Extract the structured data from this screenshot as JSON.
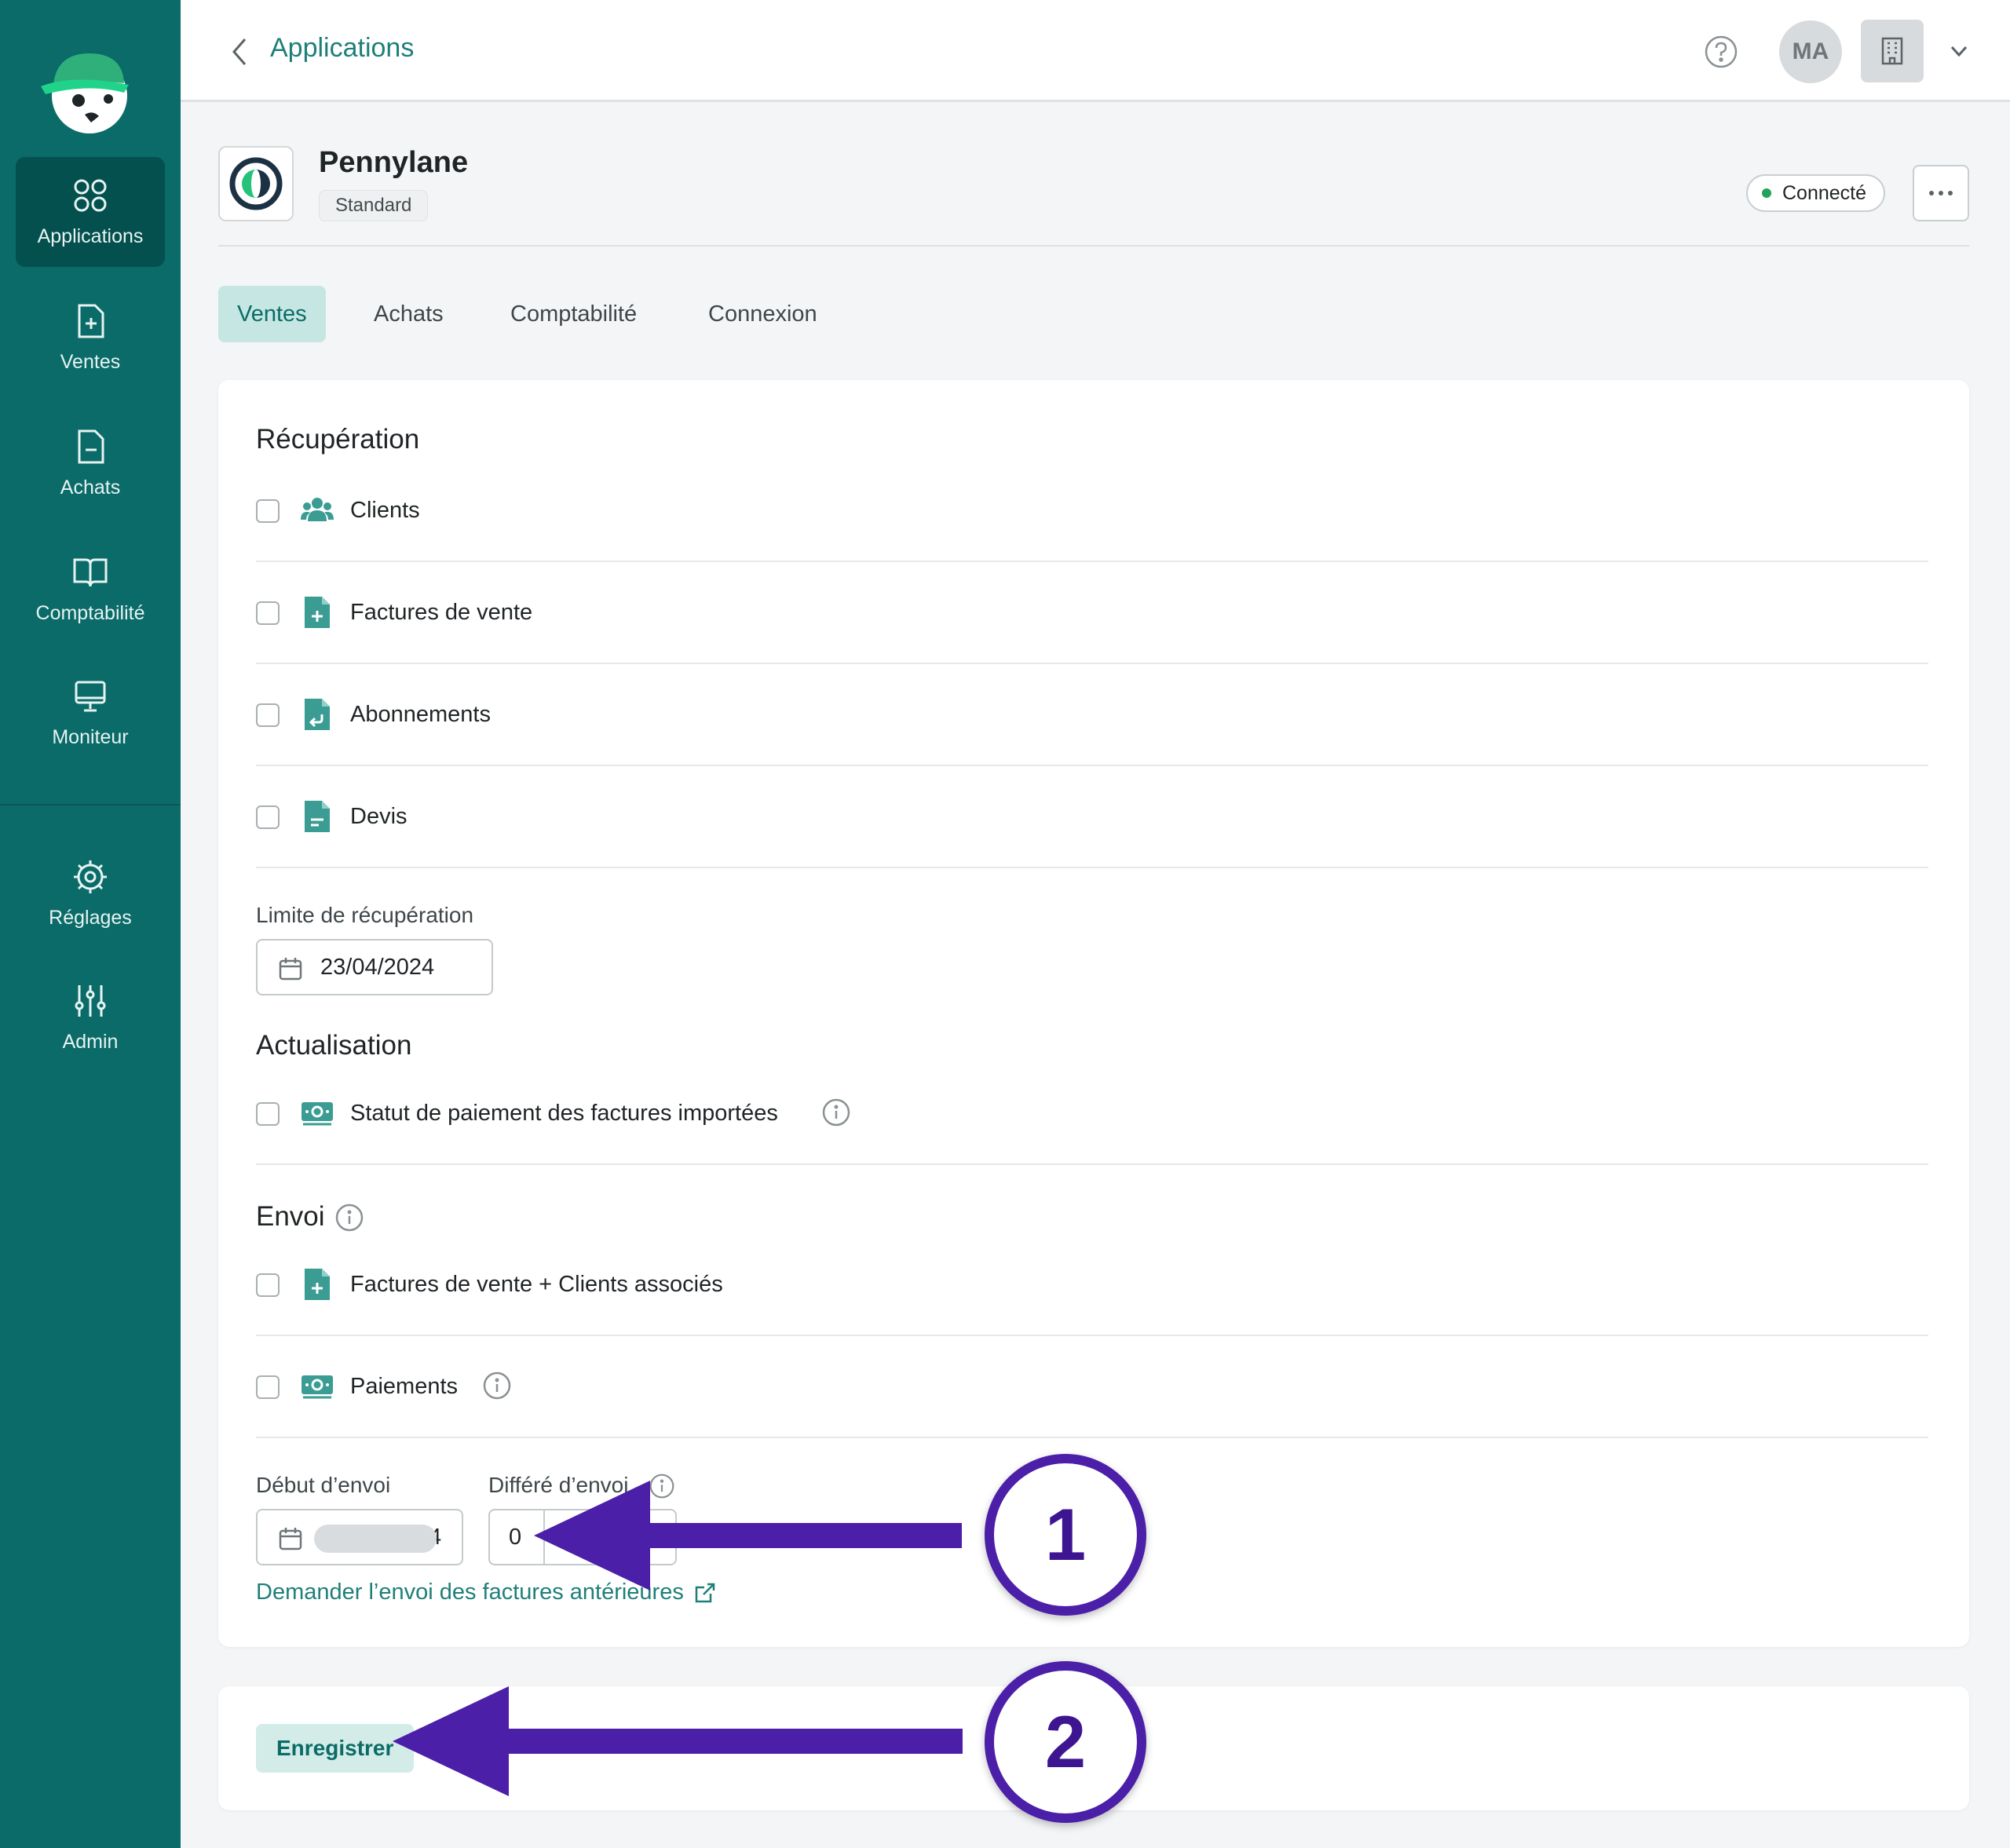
{
  "sidebar": {
    "items": [
      {
        "label": "Applications",
        "icon": "grid-icon",
        "active": true
      },
      {
        "label": "Ventes",
        "icon": "file-plus-icon"
      },
      {
        "label": "Achats",
        "icon": "file-minus-icon"
      },
      {
        "label": "Comptabilité",
        "icon": "book-icon"
      },
      {
        "label": "Moniteur",
        "icon": "monitor-icon"
      },
      {
        "label": "Réglages",
        "icon": "gear-icon"
      },
      {
        "label": "Admin",
        "icon": "sliders-icon"
      }
    ]
  },
  "header": {
    "title": "Applications",
    "avatar_initials": "MA"
  },
  "app": {
    "name": "Pennylane",
    "plan": "Standard",
    "status": "Connecté",
    "status_color": "#23a35a"
  },
  "tabs": [
    {
      "label": "Ventes",
      "active": true
    },
    {
      "label": "Achats"
    },
    {
      "label": "Comptabilité"
    },
    {
      "label": "Connexion"
    }
  ],
  "recuperation": {
    "title": "Récupération",
    "items": [
      {
        "label": "Clients",
        "icon": "users-icon"
      },
      {
        "label": "Factures de vente",
        "icon": "invoice-plus-icon"
      },
      {
        "label": "Abonnements",
        "icon": "subscription-icon"
      },
      {
        "label": "Devis",
        "icon": "quote-icon"
      }
    ],
    "limit_label": "Limite de récupération",
    "limit_value": "23/04/2024"
  },
  "actualisation": {
    "title": "Actualisation",
    "items": [
      {
        "label": "Statut de paiement des factures importées",
        "icon": "banknote-icon"
      }
    ]
  },
  "envoi": {
    "title": "Envoi",
    "items": [
      {
        "label": "Factures de vente + Clients associés",
        "icon": "invoice-plus-icon"
      },
      {
        "label": "Paiements",
        "icon": "banknote-icon"
      }
    ],
    "start_label": "Début d’envoi",
    "start_value_suffix": "4",
    "delay_label": "Différé d’envoi",
    "delay_value": "0",
    "link_label": "Demander l’envoi des factures antérieures"
  },
  "footer": {
    "save_label": "Enregistrer"
  },
  "annotations": [
    {
      "number": "1"
    },
    {
      "number": "2"
    }
  ],
  "colors": {
    "sidebar": "#0a6b68",
    "accent": "#1e7f79",
    "annotation": "#4b1fa8"
  }
}
